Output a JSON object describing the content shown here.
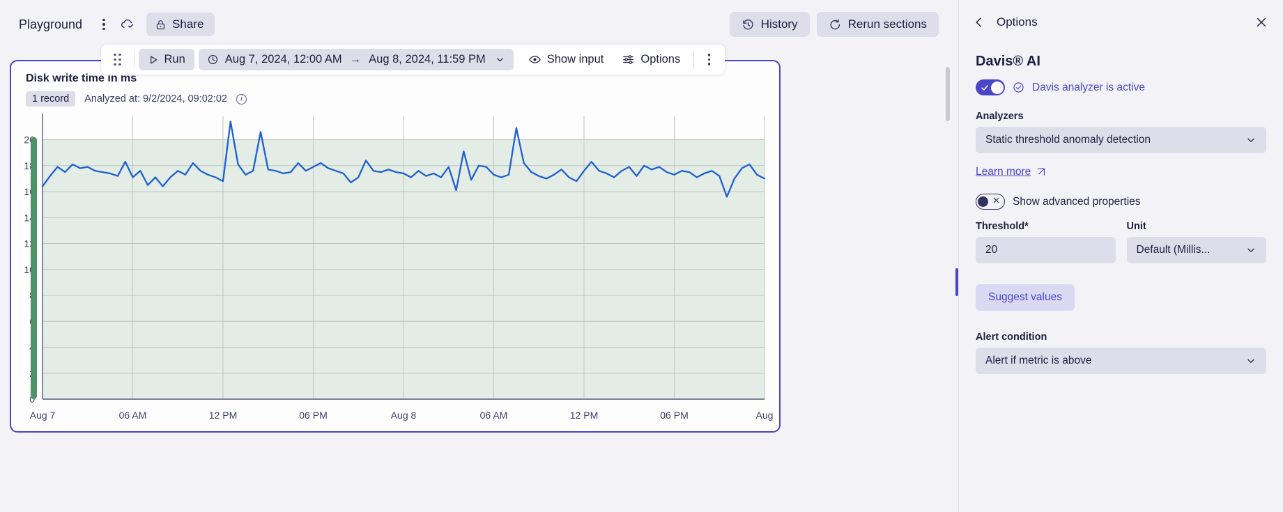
{
  "topbar": {
    "app_title": "Playground",
    "more_icon": "kebab-menu-icon",
    "cloud_icon": "cloud-saved-icon",
    "share_label": "Share",
    "share_icon": "lock-icon",
    "history_label": "History",
    "history_icon": "history-icon",
    "rerun_label": "Rerun sections",
    "rerun_icon": "refresh-icon"
  },
  "section_toolbar": {
    "grip_icon": "drag-handle-icon",
    "run_label": "Run",
    "run_icon": "play-icon",
    "clock_icon": "clock-icon",
    "date_from": "Aug 7, 2024, 12:00 AM",
    "date_arrow": "→",
    "date_to": "Aug 8, 2024, 11:59 PM",
    "date_chevron": "chevron-down-icon",
    "show_input_label": "Show input",
    "show_input_icon": "eye-icon",
    "options_label": "Options",
    "options_icon": "sliders-icon",
    "more_icon": "kebab-menu-icon"
  },
  "card": {
    "title": "Disk write time in ms",
    "record_badge": "1 record",
    "analyzed_at": "Analyzed at: 9/2/2024, 09:02:02",
    "info_icon": "info-icon",
    "info_glyph": "i"
  },
  "panel": {
    "back_icon": "chevron-left-icon",
    "title": "Options",
    "close_icon": "close-icon",
    "heading": "Davis® AI",
    "davis_toggle_state": "on",
    "davis_status": "Davis analyzer is active",
    "davis_status_icon": "check-circle-icon",
    "analyzers_label": "Analyzers",
    "analyzers_value": "Static threshold anomaly detection",
    "analyzers_chevron": "chevron-down-icon",
    "learn_more_label": "Learn more",
    "learn_more_icon": "external-link-icon",
    "advanced_toggle_state": "off",
    "advanced_label": "Show advanced properties",
    "threshold_label": "Threshold*",
    "threshold_value": "20",
    "threshold_placeholder": "Threshold",
    "unit_label": "Unit",
    "unit_value": "Default (Millis...",
    "unit_chevron": "chevron-down-icon",
    "suggest_values_label": "Suggest values",
    "alert_condition_label": "Alert condition",
    "alert_condition_value": "Alert if metric is above",
    "alert_condition_chevron": "chevron-down-icon"
  },
  "colors": {
    "accent": "#4b44c7",
    "line": "#1f5fd0",
    "band": "#e3ede6",
    "threshold_bar": "#4f9268",
    "panel_bg": "#f2f2f7",
    "control_bg": "#dedeea"
  },
  "chart_data": {
    "type": "line",
    "title": "Disk write time in ms",
    "xlabel": "",
    "ylabel": "",
    "ylim": [
      0,
      21.8
    ],
    "yticks": [
      0,
      2,
      4,
      6,
      8,
      10,
      12,
      14,
      16,
      18,
      20
    ],
    "grid": true,
    "legend": "none",
    "xtick_labels": [
      "Aug 7",
      "06 AM",
      "12 PM",
      "06 PM",
      "Aug 8",
      "06 AM",
      "12 PM",
      "06 PM",
      "Aug"
    ],
    "xtick_positions": [
      0,
      12,
      24,
      36,
      48,
      60,
      72,
      84,
      96
    ],
    "threshold": 20,
    "threshold_band": [
      0,
      20
    ],
    "series": [
      {
        "name": "Disk write time in ms",
        "color": "#1f5fd0",
        "values": [
          16.4,
          17.2,
          17.9,
          17.5,
          18.1,
          17.8,
          17.9,
          17.6,
          17.5,
          17.4,
          17.2,
          18.3,
          17.1,
          17.6,
          16.5,
          17.1,
          16.4,
          17.1,
          17.6,
          17.3,
          18.2,
          17.6,
          17.3,
          17.1,
          16.8,
          21.4,
          18.1,
          17.3,
          17.6,
          20.6,
          17.7,
          17.6,
          17.4,
          17.5,
          18.2,
          17.6,
          17.9,
          18.2,
          17.8,
          17.6,
          17.4,
          16.7,
          17.1,
          18.4,
          17.6,
          17.5,
          17.7,
          17.5,
          17.4,
          17.1,
          17.6,
          17.2,
          17.4,
          17.1,
          17.9,
          16.1,
          19.1,
          16.9,
          18.0,
          17.9,
          17.3,
          17.1,
          17.3,
          20.9,
          18.2,
          17.5,
          17.2,
          17.0,
          17.3,
          17.7,
          17.1,
          16.8,
          17.6,
          18.3,
          17.6,
          17.4,
          17.1,
          17.6,
          17.9,
          17.2,
          18.0,
          17.7,
          17.9,
          17.5,
          17.3,
          17.6,
          17.5,
          17.1,
          17.4,
          17.6,
          17.2,
          15.6,
          17.0,
          17.8,
          18.1,
          17.3,
          17.0
        ]
      }
    ]
  }
}
